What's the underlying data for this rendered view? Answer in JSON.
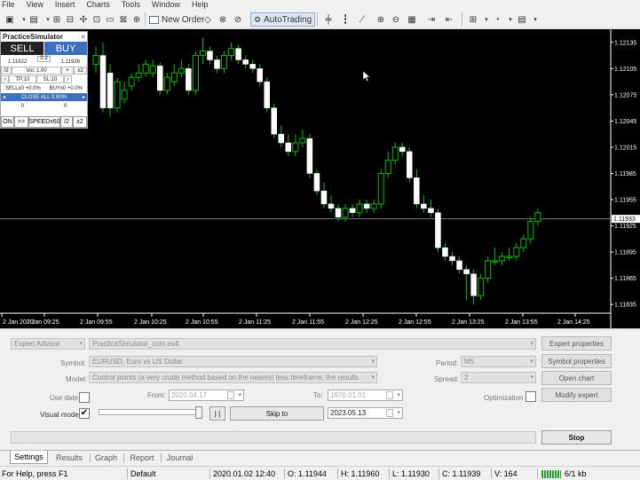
{
  "menu": [
    "File",
    "View",
    "Insert",
    "Charts",
    "Tools",
    "Window",
    "Help"
  ],
  "toolbar": {
    "new_order": "New Order",
    "autotrading": "AutoTrading"
  },
  "chart": {
    "price_labels": [
      "1.12135",
      "1.12105",
      "1.12075",
      "1.12045",
      "1.12015",
      "1.11985",
      "1.11955",
      "1.11925",
      "1.11895",
      "1.11865",
      "1.11835"
    ],
    "current_price": "1.11933",
    "time_labels": [
      "2 Jan 2020",
      "2 Jan 09:25",
      "2 Jan 09:55",
      "2 Jan 10:25",
      "2 Jan 10:55",
      "2 Jan 11:25",
      "2 Jan 11:55",
      "2 Jan 12:25",
      "2 Jan 12:55",
      "2 Jan 13:25",
      "2 Jan 13:55",
      "2 Jan 14:25"
    ],
    "colors": {
      "background": "#000000",
      "bull": "#ffffff",
      "bear": "#ffffff",
      "wick": "#00c000",
      "price_line": "#777777"
    }
  },
  "chart_data": {
    "type": "candlestick",
    "x": [
      "09:15",
      "09:20",
      "09:25",
      "09:30",
      "09:35",
      "09:40",
      "09:45",
      "09:50",
      "09:55",
      "10:00",
      "10:05",
      "10:10",
      "10:15",
      "10:20",
      "10:25",
      "10:30",
      "10:35",
      "10:40",
      "10:45",
      "10:50",
      "10:55",
      "11:00",
      "11:05",
      "11:10",
      "11:15",
      "11:20",
      "11:25",
      "11:30",
      "11:35",
      "11:40",
      "11:45",
      "11:50",
      "11:55",
      "12:00",
      "12:05",
      "12:10",
      "12:15",
      "12:20",
      "12:25",
      "12:30",
      "12:35",
      "12:40",
      "12:45",
      "12:50",
      "12:55",
      "13:00",
      "13:05",
      "13:10",
      "13:15",
      "13:20",
      "13:25",
      "13:30",
      "13:35",
      "13:40",
      "13:45",
      "13:50",
      "13:55",
      "14:00",
      "14:05",
      "14:10",
      "14:15",
      "14:20",
      "14:25"
    ],
    "open": [
      1.1211,
      1.1212,
      1.121,
      1.1206,
      1.1207,
      1.12085,
      1.12095,
      1.121,
      1.121,
      1.12108,
      1.1208,
      1.1209,
      1.121,
      1.12105,
      1.1208,
      1.1212,
      1.12125,
      1.12115,
      1.12105,
      1.1212,
      1.12128,
      1.12115,
      1.1211,
      1.12105,
      1.1209,
      1.1206,
      1.1203,
      1.1202,
      1.1201,
      1.1202,
      1.12025,
      1.11985,
      1.11965,
      1.1195,
      1.11945,
      1.11935,
      1.11945,
      1.1194,
      1.1195,
      1.11945,
      1.1195,
      1.11985,
      1.12,
      1.12015,
      1.1201,
      1.1198,
      1.1195,
      1.11945,
      1.1194,
      1.119,
      1.1189,
      1.11885,
      1.11875,
      1.1187,
      1.11845,
      1.11865,
      1.11885,
      1.11885,
      1.1189,
      1.1189,
      1.119,
      1.1191,
      1.1193
    ],
    "close": [
      1.1212,
      1.1206,
      1.1206,
      1.1209,
      1.1208,
      1.12095,
      1.121,
      1.1211,
      1.12108,
      1.1208,
      1.12095,
      1.121,
      1.12105,
      1.1208,
      1.1212,
      1.12125,
      1.12115,
      1.12105,
      1.1212,
      1.12128,
      1.12115,
      1.1211,
      1.12105,
      1.1209,
      1.1206,
      1.1203,
      1.1202,
      1.1201,
      1.1202,
      1.12025,
      1.11985,
      1.11965,
      1.1195,
      1.11945,
      1.11935,
      1.11945,
      1.1194,
      1.1195,
      1.11945,
      1.1195,
      1.11985,
      1.12,
      1.12015,
      1.1201,
      1.1198,
      1.1195,
      1.11945,
      1.1194,
      1.119,
      1.1189,
      1.11885,
      1.11875,
      1.1187,
      1.11845,
      1.11865,
      1.11885,
      1.11885,
      1.1189,
      1.1189,
      1.119,
      1.1191,
      1.1193,
      1.1194
    ],
    "high": [
      1.1213,
      1.12135,
      1.1211,
      1.12095,
      1.1209,
      1.121,
      1.1211,
      1.12115,
      1.12115,
      1.12112,
      1.121,
      1.1211,
      1.12115,
      1.1211,
      1.12125,
      1.1214,
      1.1213,
      1.1212,
      1.12125,
      1.12135,
      1.12132,
      1.1212,
      1.12115,
      1.1211,
      1.12095,
      1.12065,
      1.1204,
      1.1203,
      1.1203,
      1.12035,
      1.1203,
      1.1199,
      1.11975,
      1.1196,
      1.1195,
      1.1195,
      1.1195,
      1.11955,
      1.11955,
      1.11955,
      1.1199,
      1.1201,
      1.1202,
      1.1202,
      1.12015,
      1.1199,
      1.1196,
      1.11955,
      1.11945,
      1.11905,
      1.11895,
      1.1189,
      1.1188,
      1.11875,
      1.1187,
      1.1189,
      1.119,
      1.11895,
      1.119,
      1.11905,
      1.11915,
      1.11935,
      1.11945
    ],
    "low": [
      1.121,
      1.12055,
      1.1205,
      1.12055,
      1.12065,
      1.1208,
      1.1209,
      1.12095,
      1.12095,
      1.12075,
      1.12075,
      1.12085,
      1.12095,
      1.12075,
      1.12075,
      1.1211,
      1.1211,
      1.121,
      1.121,
      1.12115,
      1.1211,
      1.12105,
      1.121,
      1.12085,
      1.12055,
      1.12025,
      1.12015,
      1.12005,
      1.12005,
      1.12015,
      1.1198,
      1.1196,
      1.11945,
      1.1194,
      1.1193,
      1.1193,
      1.11935,
      1.11935,
      1.1194,
      1.1194,
      1.11945,
      1.1198,
      1.11995,
      1.12005,
      1.11975,
      1.11945,
      1.1194,
      1.11935,
      1.11895,
      1.11885,
      1.1188,
      1.1187,
      1.1184,
      1.11835,
      1.1184,
      1.1186,
      1.1188,
      1.1188,
      1.11885,
      1.11885,
      1.11895,
      1.11905,
      1.11925
    ],
    "ylim": [
      1.11825,
      1.1215
    ],
    "grid": false
  },
  "simulator": {
    "title": "PracticeSimulator",
    "close_glyph": "×",
    "sell_label": "SELL",
    "buy_label": "BUY",
    "spread": "0.2",
    "bid": "1.11922",
    "ask": "1.11926",
    "minus": "/2",
    "vol": "Vol: 1.00",
    "plus": "+",
    "times2": "x2",
    "tp": "TP:10",
    "sl": "SL:10",
    "sell_pl": "SELLx0 +0.0%",
    "buy_pl": "BUYx0 +0.0%",
    "close_all": "CLOSE ALL 0.00%",
    "count_sell": "0",
    "count_buy": "0",
    "on": "ON",
    "ff": ">>",
    "speed": "SPEEDx60",
    "half": "/2",
    "double": "x2"
  },
  "tester": {
    "expert_type": "Expert Advisor",
    "expert_file": "PracticeSimulator_com.ex4",
    "symbol_label": "Symbol:",
    "symbol_value": "EURUSD, Euro vs US Dollar",
    "model_label": "Model:",
    "model_value": "Control points (a very crude method based on the nearest less timeframe, the results",
    "use_date_label": "Use date",
    "from_label": "From:",
    "from_value": "2020.04.17",
    "to_label": "To:",
    "to_value": "1970.01.01",
    "visual_mode_label": "Visual mode",
    "visual_mode_checked": "✔",
    "pause_glyph": "| |",
    "skip_to_label": "Skip to",
    "skip_to_value": "2023.05.13",
    "period_label": "Period:",
    "period_value": "M5",
    "spread_label": "Spread:",
    "spread_value": "2",
    "optimization_label": "Optimization",
    "expert_properties": "Expert properties",
    "symbol_properties": "Symbol properties",
    "open_chart": "Open chart",
    "modify_expert": "Modify expert",
    "stop": "Stop"
  },
  "tabs": [
    "Settings",
    "Results",
    "Graph",
    "Report",
    "Journal"
  ],
  "status": {
    "help": "For Help, press F1",
    "profile": "Default",
    "datetime": "2020.01.02 12:40",
    "open": "O: 1.11944",
    "high": "H: 1.11960",
    "low": "L: 1.11930",
    "close": "C: 1.11939",
    "volume": "V: 164",
    "traffic": "6/1 kb"
  }
}
